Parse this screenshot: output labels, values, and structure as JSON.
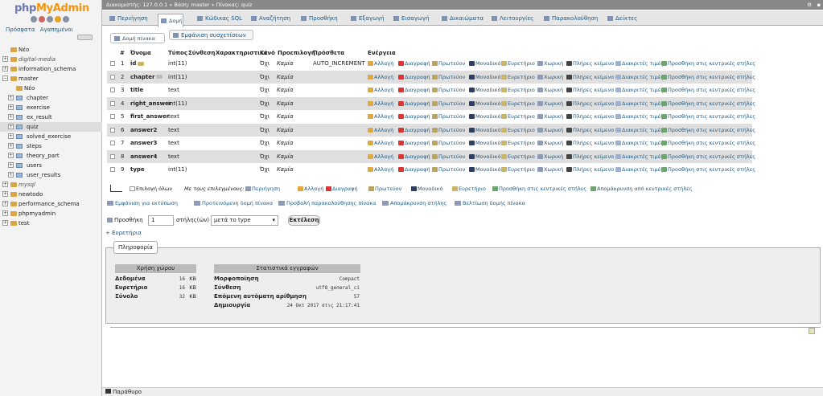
{
  "nav": {
    "logo_a": "php",
    "logo_b": "MyAdmin",
    "tab_recent": "Πρόσφατα",
    "tab_favorites": "Αγαπημένοι",
    "tree": [
      {
        "label": "Νέο",
        "level": 0,
        "type": "new",
        "italic": false
      },
      {
        "label": "digital-media",
        "level": 0,
        "type": "db",
        "italic": true
      },
      {
        "label": "information_schema",
        "level": 0,
        "type": "db",
        "italic": false
      },
      {
        "label": "master",
        "level": 0,
        "type": "db",
        "italic": false,
        "expanded": true
      },
      {
        "label": "Νέο",
        "level": 1,
        "type": "new",
        "italic": false
      },
      {
        "label": "chapter",
        "level": 1,
        "type": "table",
        "italic": false
      },
      {
        "label": "exercise",
        "level": 1,
        "type": "table",
        "italic": false
      },
      {
        "label": "ex_result",
        "level": 1,
        "type": "table",
        "italic": false
      },
      {
        "label": "quiz",
        "level": 1,
        "type": "table",
        "italic": false,
        "selected": true
      },
      {
        "label": "solved_exercise",
        "level": 1,
        "type": "table",
        "italic": false
      },
      {
        "label": "steps",
        "level": 1,
        "type": "table",
        "italic": false
      },
      {
        "label": "theory_part",
        "level": 1,
        "type": "table",
        "italic": false
      },
      {
        "label": "users",
        "level": 1,
        "type": "table",
        "italic": false
      },
      {
        "label": "user_results",
        "level": 1,
        "type": "table",
        "italic": false
      },
      {
        "label": "mysql",
        "level": 0,
        "type": "db",
        "italic": true
      },
      {
        "label": "newtodo",
        "level": 0,
        "type": "db",
        "italic": false
      },
      {
        "label": "performance_schema",
        "level": 0,
        "type": "db",
        "italic": false
      },
      {
        "label": "phpmyadmin",
        "level": 0,
        "type": "db",
        "italic": false
      },
      {
        "label": "test",
        "level": 0,
        "type": "db",
        "italic": false
      }
    ]
  },
  "breadcrumb": "Διακομιστής: 127.0.0.1 » Βάση: master » Πίνακας: quiz",
  "tabs": [
    "Περιήγηση",
    "Δομή",
    "Κώδικας SQL",
    "Αναζήτηση",
    "Προσθήκη",
    "Εξαγωγή",
    "Εισαγωγή",
    "Δικαιώματα",
    "Λειτουργίες",
    "Παρακολούθηση",
    "Δείκτες"
  ],
  "active_tab": "Δομή",
  "subtabs": [
    "Δομή πίνακα",
    "Εμφάνιση συσχετίσεων"
  ],
  "columns_header": [
    "#",
    "Όνομα",
    "Τύπος",
    "Σύνθεση",
    "Χαρακτηριστικά",
    "Κενό",
    "Προεπιλογή",
    "Πρόσθετα",
    "Ενέργεια"
  ],
  "rows": [
    {
      "n": "1",
      "name": "id",
      "type": "int(11)",
      "nul": "Όχι",
      "def": "Καμία",
      "extra": "AUTO_INCREMENT",
      "key": "primary"
    },
    {
      "n": "2",
      "name": "chapter",
      "type": "int(11)",
      "nul": "Όχι",
      "def": "Καμία",
      "extra": "",
      "key": "index"
    },
    {
      "n": "3",
      "name": "title",
      "type": "text",
      "nul": "Όχι",
      "def": "Καμία",
      "extra": "",
      "key": ""
    },
    {
      "n": "4",
      "name": "right_answer",
      "type": "int(11)",
      "nul": "Όχι",
      "def": "Καμία",
      "extra": "",
      "key": ""
    },
    {
      "n": "5",
      "name": "first_answer",
      "type": "text",
      "nul": "Όχι",
      "def": "Καμία",
      "extra": "",
      "key": ""
    },
    {
      "n": "6",
      "name": "answer2",
      "type": "text",
      "nul": "Όχι",
      "def": "Καμία",
      "extra": "",
      "key": ""
    },
    {
      "n": "7",
      "name": "answer3",
      "type": "text",
      "nul": "Όχι",
      "def": "Καμία",
      "extra": "",
      "key": ""
    },
    {
      "n": "8",
      "name": "answer4",
      "type": "text",
      "nul": "Όχι",
      "def": "Καμία",
      "extra": "",
      "key": ""
    },
    {
      "n": "9",
      "name": "type",
      "type": "int(11)",
      "nul": "Όχι",
      "def": "Καμία",
      "extra": "",
      "key": ""
    }
  ],
  "row_actions": [
    "Αλλαγή",
    "Διαγραφή",
    "Πρωτεύον",
    "Μοναδικό",
    "Ευρετήριο",
    "Χωρική",
    "Πλήρες κείμενο",
    "Διακριτές τιμές",
    "Προσθήκη στις κεντρικές στήλες"
  ],
  "bulk": {
    "check_all": "Επιλογή όλων",
    "with_selected": "Με τους επιλεγμένους:",
    "actions": [
      "Περιήγηση",
      "Αλλαγή",
      "Διαγραφή",
      "Πρωτεύον",
      "Μοναδικό",
      "Ευρετήριο",
      "Προσθήκη στις κεντρικές στήλες",
      "Απομάκρυνση από κεντρικές στήλες"
    ]
  },
  "links2": [
    "Εμφάνιση για εκτύπωση",
    "Προτεινόμενη δομή πίνακα",
    "Προβολή παρακολούθησης πίνακα",
    "Απομάκρυνση στήλης",
    "Βελτίωση δομής πίνακα"
  ],
  "add": {
    "label": "Προσθήκη",
    "count": "1",
    "columns": "στήλης(ών)",
    "position": "μετά το type",
    "go": "Εκτέλεση"
  },
  "index_link": "+ Ευρετήρια",
  "info": {
    "tab": "Πληροφορία",
    "space_title": "Χρήση χώρου",
    "space": [
      {
        "label": "Δεδομένα",
        "value": "16",
        "unit": "KB"
      },
      {
        "label": "Ευρετήριο",
        "value": "16",
        "unit": "KB"
      },
      {
        "label": "Σύνολο",
        "value": "32",
        "unit": "KB"
      }
    ],
    "stats_title": "Στατιστικά εγγραφών",
    "stats": [
      {
        "label": "Μορφοποίηση",
        "value": "Compact"
      },
      {
        "label": "Σύνθεση",
        "value": "utf8_general_ci"
      },
      {
        "label": "Επόμενη αυτόματη αρίθμηση",
        "value": "57"
      },
      {
        "label": "Δημιουργία",
        "value": "24 Οκτ 2017 στις 21:17:41"
      }
    ]
  },
  "console": "Παράθυρο"
}
